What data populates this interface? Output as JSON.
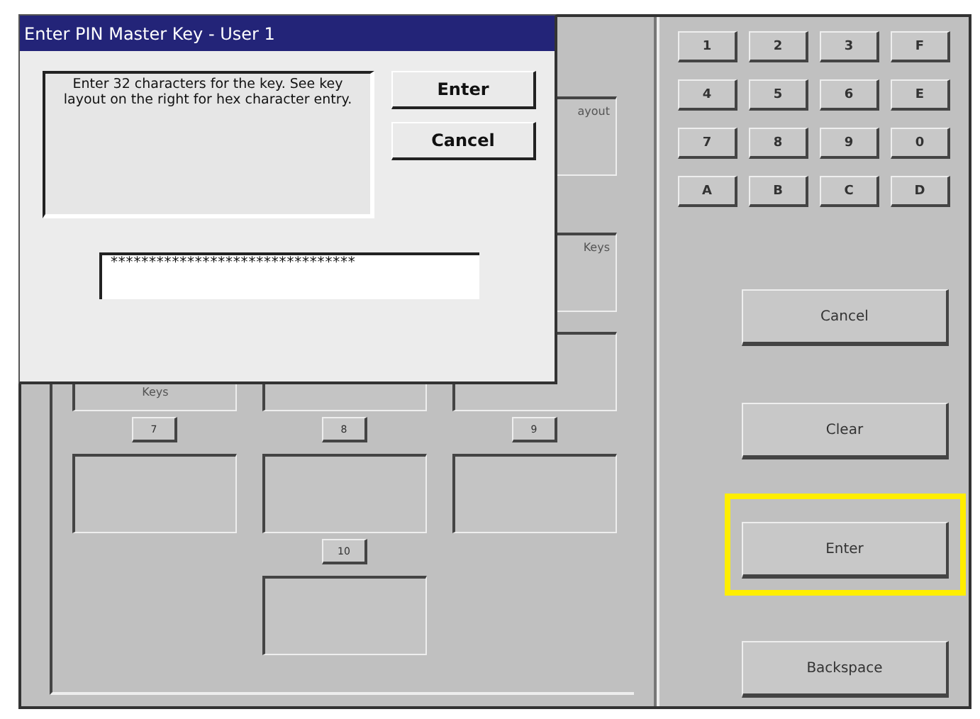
{
  "dialog": {
    "title": "Enter PIN Master Key - User 1",
    "message": "Enter 32 characters for the key. See key layout on the right for hex character entry.",
    "buttons": [
      "Enter",
      "Cancel"
    ],
    "field": {
      "value": "********************************"
    }
  },
  "background_panel": {
    "box_labels": [
      "ayout",
      "Keys",
      "Keys"
    ],
    "slot_buttons": [
      "7",
      "8",
      "9",
      "10"
    ]
  },
  "keypad": {
    "keys": [
      "1",
      "2",
      "3",
      "F",
      "4",
      "5",
      "6",
      "E",
      "7",
      "8",
      "9",
      "0",
      "A",
      "B",
      "C",
      "D"
    ]
  },
  "actions": [
    {
      "label": "Cancel",
      "highlighted": false
    },
    {
      "label": "Clear",
      "highlighted": false
    },
    {
      "label": "Enter",
      "highlighted": true
    },
    {
      "label": "Backspace",
      "highlighted": false
    }
  ]
}
